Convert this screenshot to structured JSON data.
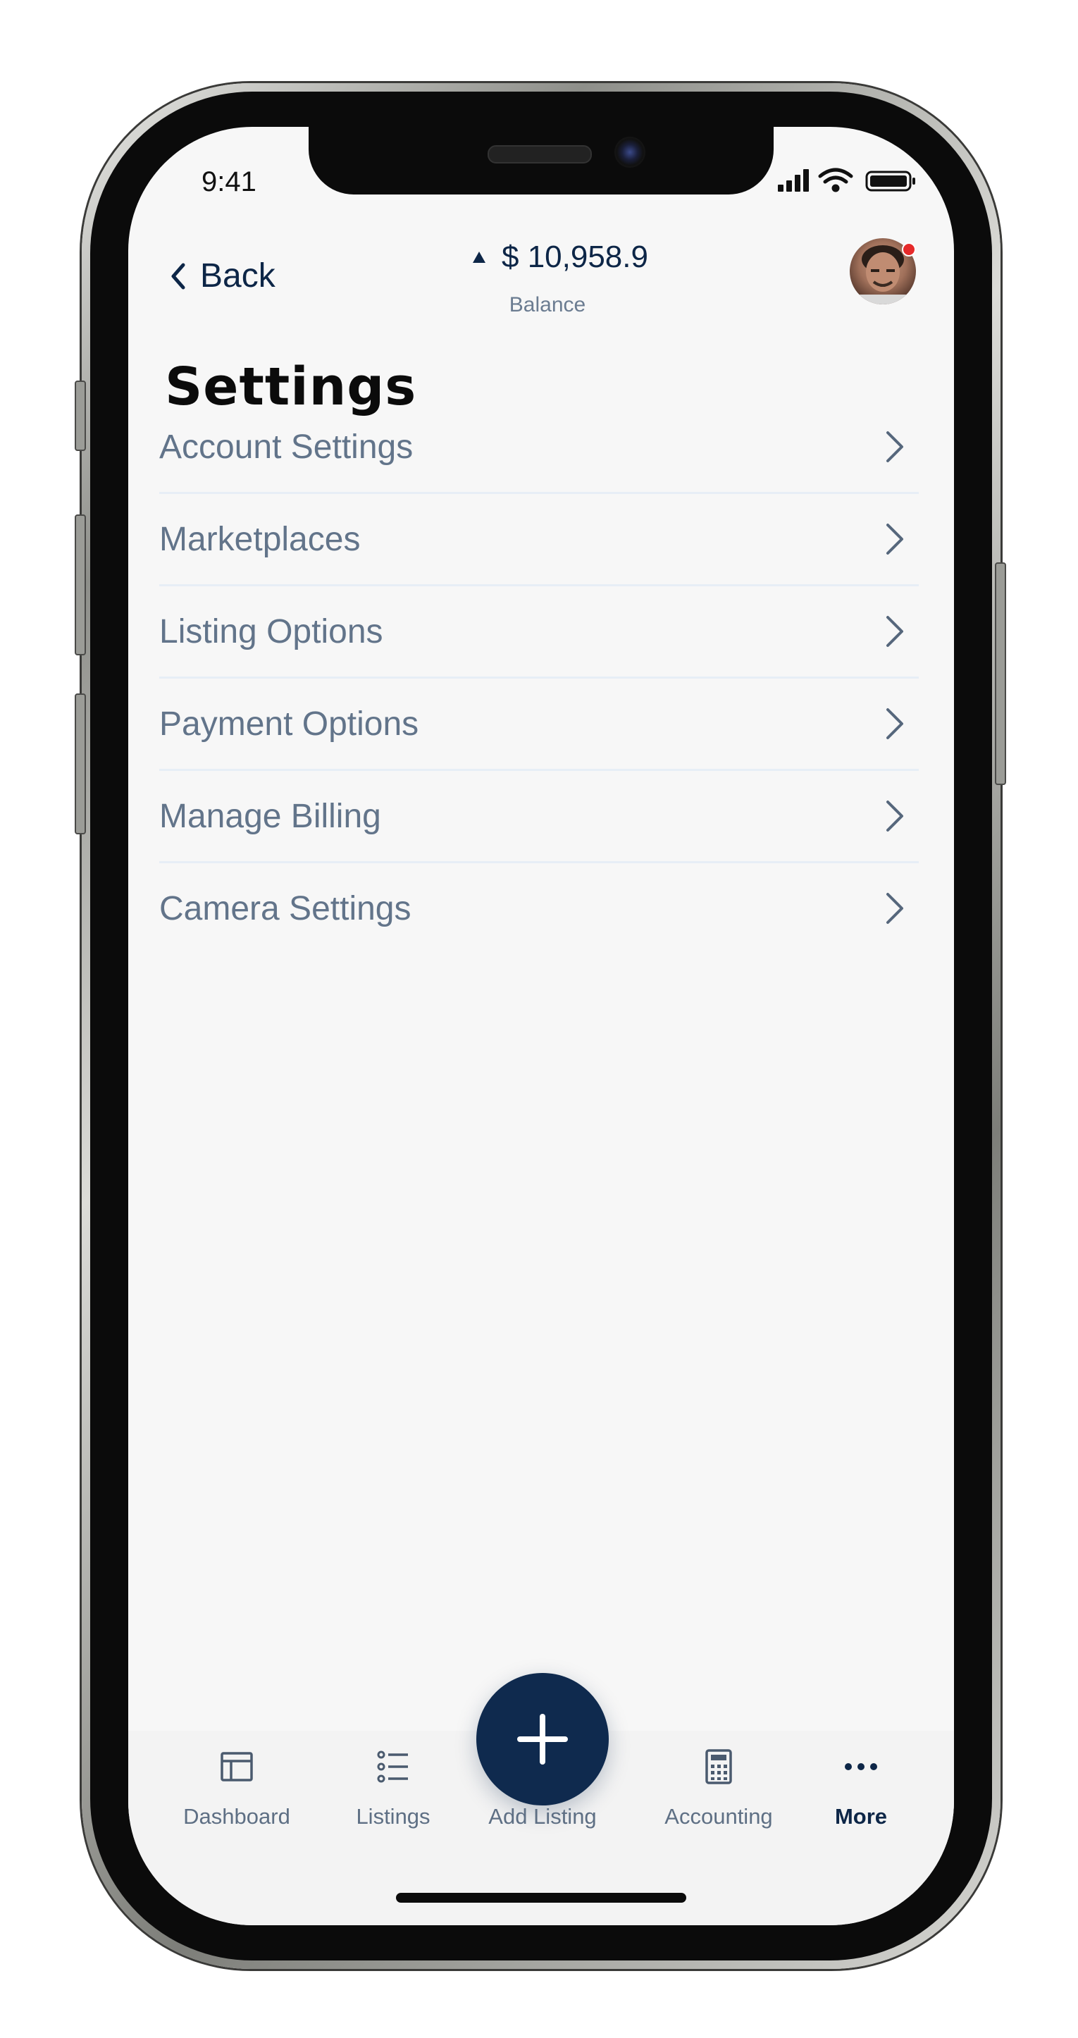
{
  "status_bar": {
    "time": "9:41"
  },
  "header": {
    "back_label": "Back",
    "balance_amount": "$ 10,958.9",
    "balance_label": "Balance"
  },
  "page": {
    "title": "Settings"
  },
  "settings": {
    "items": [
      {
        "label": "Account Settings"
      },
      {
        "label": "Marketplaces"
      },
      {
        "label": "Listing Options"
      },
      {
        "label": "Payment Options"
      },
      {
        "label": "Manage Billing"
      },
      {
        "label": "Camera Settings"
      }
    ]
  },
  "bottom_nav": {
    "items": [
      {
        "label": "Dashboard",
        "icon": "dashboard-icon"
      },
      {
        "label": "Listings",
        "icon": "list-icon"
      },
      {
        "label": "Add Listing",
        "icon": "plus-icon"
      },
      {
        "label": "Accounting",
        "icon": "calculator-icon"
      },
      {
        "label": "More",
        "icon": "more-dots-icon"
      }
    ],
    "active": "More"
  },
  "colors": {
    "navy": "#0f2a4e",
    "list_text": "#62748a",
    "divider": "#e7eef6",
    "notification": "#e62a2a"
  }
}
